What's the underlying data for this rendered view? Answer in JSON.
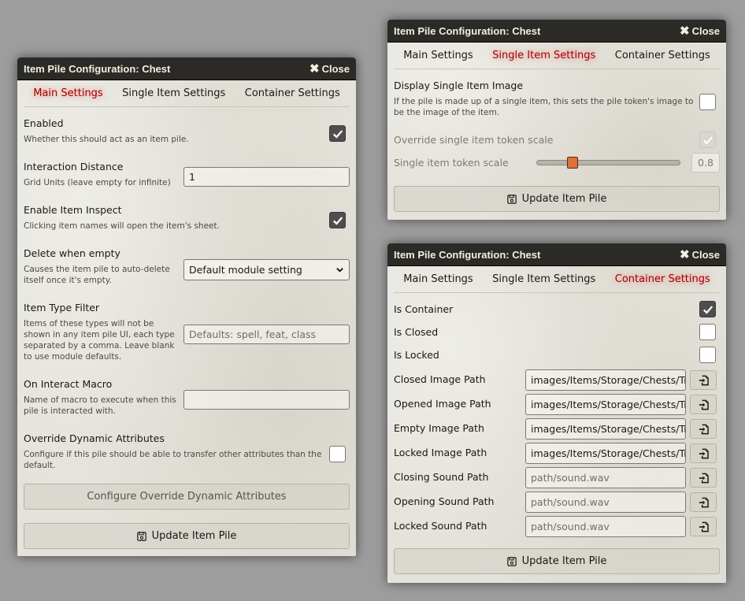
{
  "left": {
    "title": "Item Pile Configuration: Chest",
    "close_label": "Close",
    "tabs": [
      "Main Settings",
      "Single Item Settings",
      "Container Settings"
    ],
    "active_tab": "Main Settings",
    "enabled": {
      "label": "Enabled",
      "hint": "Whether this should act as an item pile.",
      "checked": true
    },
    "interaction_distance": {
      "label": "Interaction Distance",
      "hint": "Grid Units (leave empty for infinite)",
      "value": "1"
    },
    "enable_inspect": {
      "label": "Enable Item Inspect",
      "hint": "Clicking item names will open the item's sheet.",
      "checked": true
    },
    "delete_when_empty": {
      "label": "Delete when empty",
      "hint1": "Causes the item pile to auto-delete",
      "hint2": "itself once it's empty.",
      "value": "Default module setting"
    },
    "item_type_filter": {
      "label": "Item Type Filter",
      "hint1": "Items of these types will not be",
      "hint2": "shown in any item pile UI, each type",
      "hint3": "separated by a comma. Leave blank",
      "hint4": "to use module defaults.",
      "placeholder": "Defaults: spell, feat, class"
    },
    "on_interact_macro": {
      "label": "On Interact Macro",
      "hint1": "Name of macro to execute when this",
      "hint2": "pile is interacted with.",
      "value": ""
    },
    "override_dynamic": {
      "label": "Override Dynamic Attributes",
      "hint1": "Configure if this pile should be able to transfer other attributes than the",
      "hint2": "default.",
      "checked": false
    },
    "configure_button": "Configure Override Dynamic Attributes",
    "update_button": "Update Item Pile"
  },
  "top_right": {
    "title": "Item Pile Configuration: Chest",
    "close_label": "Close",
    "tabs": [
      "Main Settings",
      "Single Item Settings",
      "Container Settings"
    ],
    "active_tab": "Single Item Settings",
    "display_single": {
      "label": "Display Single Item Image",
      "hint1": "If the pile is made up of a single item, this sets the pile token's image to",
      "hint2": "be the image of the item.",
      "checked": false
    },
    "override_scale": {
      "label": "Override single item token scale",
      "checked": true
    },
    "token_scale": {
      "label": "Single item token scale",
      "value": "0.8",
      "fraction": 0.25
    },
    "update_button": "Update Item Pile"
  },
  "bottom_right": {
    "title": "Item Pile Configuration: Chest",
    "close_label": "Close",
    "tabs": [
      "Main Settings",
      "Single Item Settings",
      "Container Settings"
    ],
    "active_tab": "Container Settings",
    "is_container": {
      "label": "Is Container",
      "checked": true
    },
    "is_closed": {
      "label": "Is Closed",
      "checked": false
    },
    "is_locked": {
      "label": "Is Locked",
      "checked": false
    },
    "paths": [
      {
        "label": "Closed Image Path",
        "value": "images/Items/Storage/Chests/Tr",
        "placeholder": false
      },
      {
        "label": "Opened Image Path",
        "value": "images/Items/Storage/Chests/Tr",
        "placeholder": false
      },
      {
        "label": "Empty Image Path",
        "value": "images/Items/Storage/Chests/Tr",
        "placeholder": false
      },
      {
        "label": "Locked Image Path",
        "value": "images/Items/Storage/Chests/Tr",
        "placeholder": false
      },
      {
        "label": "Closing Sound Path",
        "value": "path/sound.wav",
        "placeholder": true
      },
      {
        "label": "Opening Sound Path",
        "value": "path/sound.wav",
        "placeholder": true
      },
      {
        "label": "Locked Sound Path",
        "value": "path/sound.wav",
        "placeholder": true
      }
    ],
    "update_button": "Update Item Pile"
  },
  "icons": {
    "close": "close-icon",
    "check": "check-icon",
    "save": "save-icon",
    "file_picker": "file-import-icon",
    "chevron": "chevron-down-icon"
  }
}
